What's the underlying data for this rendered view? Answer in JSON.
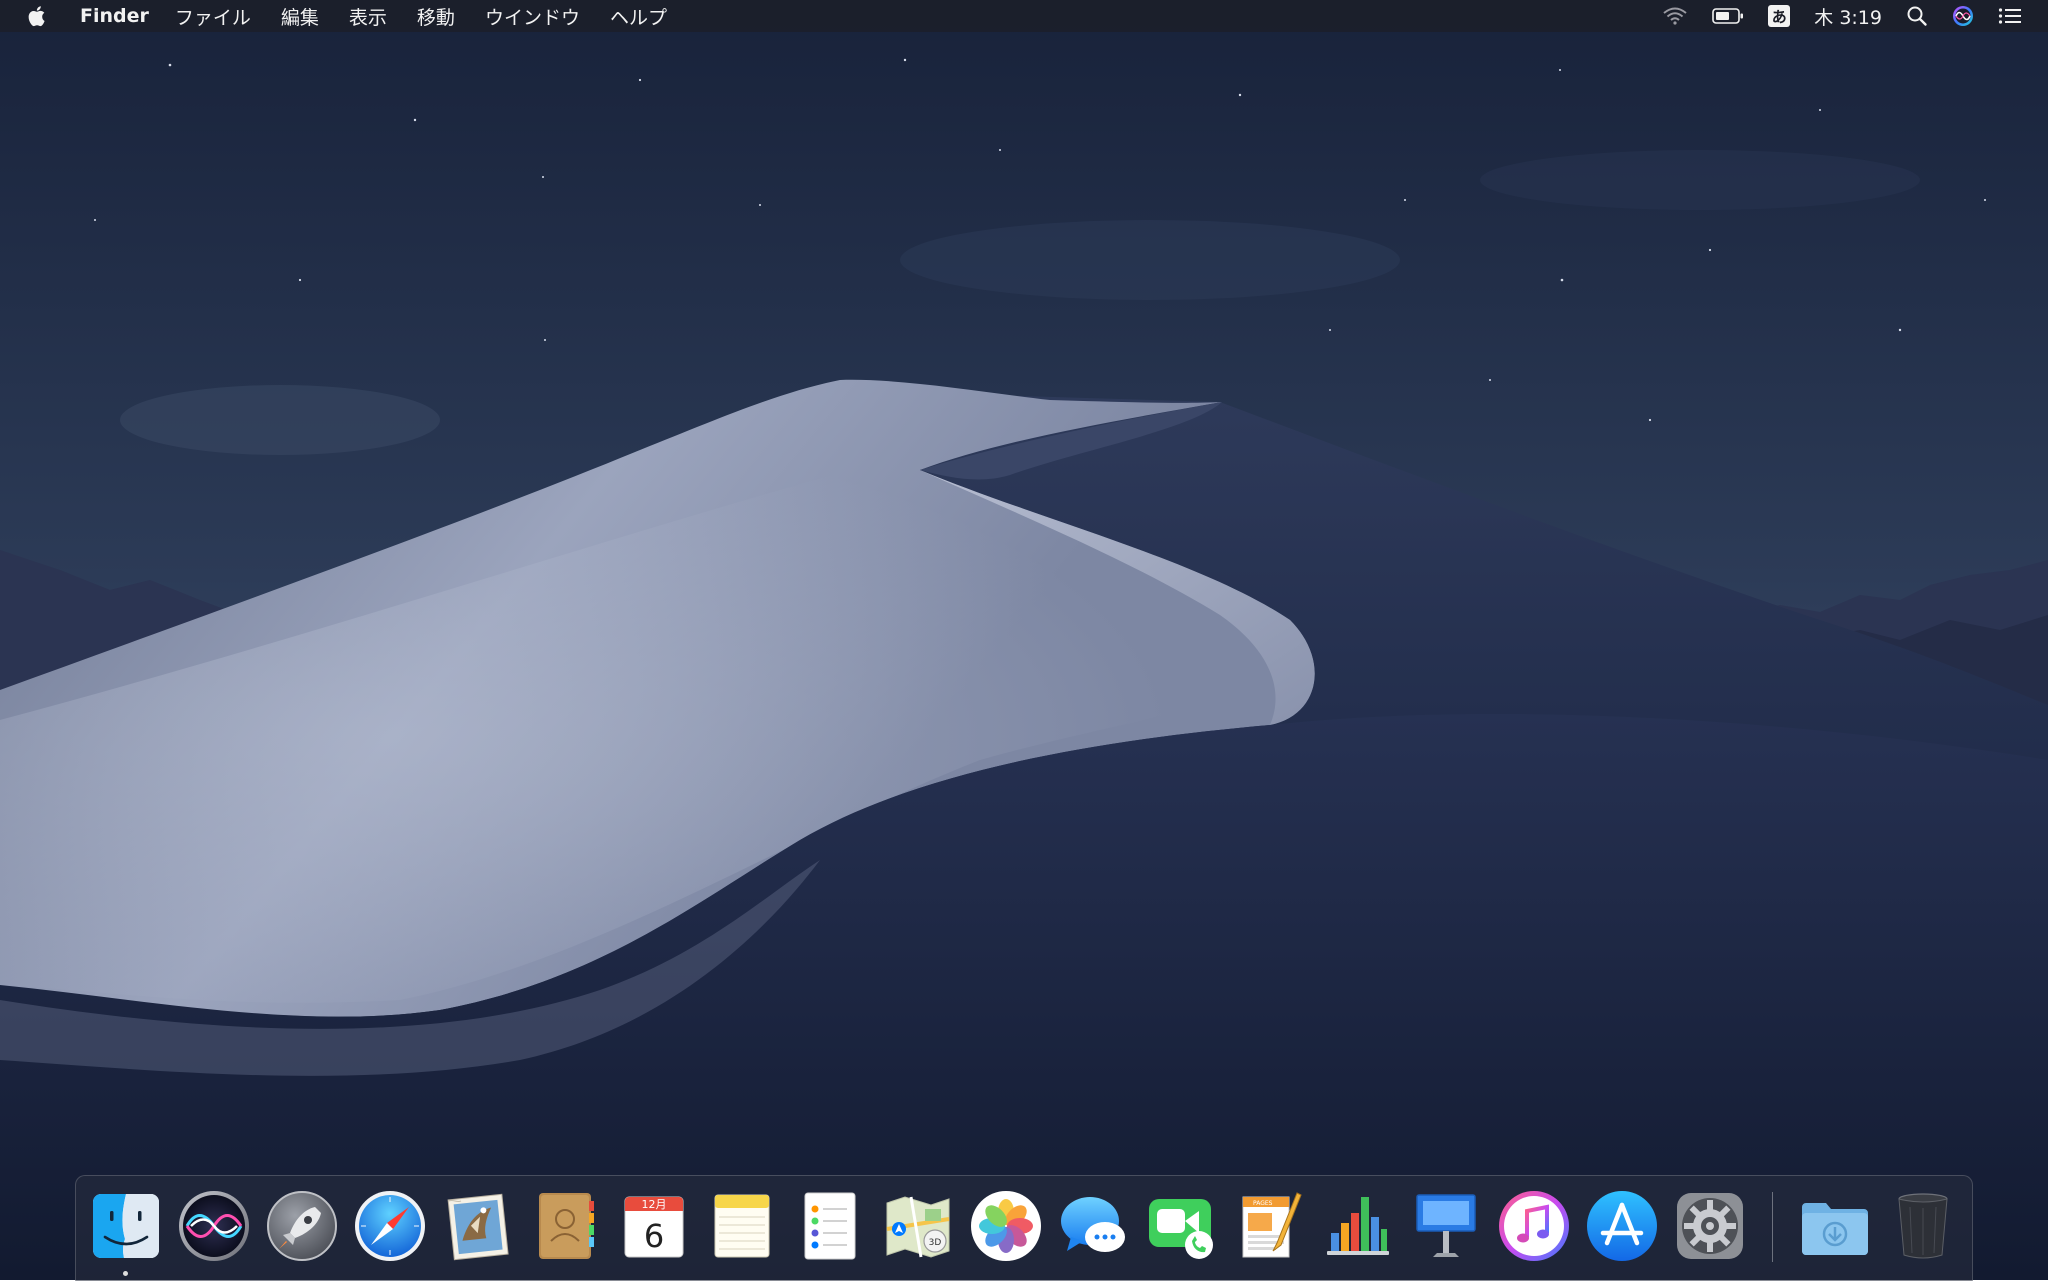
{
  "menubar": {
    "app_name": "Finder",
    "menus": [
      "ファイル",
      "編集",
      "表示",
      "移動",
      "ウインドウ",
      "ヘルプ"
    ],
    "input_method": "あ",
    "clock": "木 3:19",
    "icons": [
      "apple-icon",
      "wifi-icon",
      "battery-icon",
      "input-method-icon",
      "spotlight-icon",
      "siri-icon",
      "notification-center-icon"
    ]
  },
  "dock": {
    "items": [
      "Finder",
      "Siri",
      "Launchpad",
      "Safari",
      "Mail",
      "Contacts",
      "Calendar",
      "Notes",
      "Reminders",
      "Maps",
      "Photos",
      "Messages",
      "FaceTime",
      "Pages",
      "Numbers",
      "Keynote",
      "iTunes",
      "App Store",
      "System Preferences",
      "Downloads",
      "Trash"
    ],
    "calendar_month": "12月",
    "calendar_day": "6",
    "pages_label": "PAGES",
    "running": [
      "Finder"
    ]
  },
  "colors": {
    "menubar_bg": "#1c1e28",
    "sky_top": "#1a2438",
    "sky_bottom": "#4b5e7c",
    "dune_light": "#8e97b2",
    "dune_dark": "#1c2644"
  }
}
